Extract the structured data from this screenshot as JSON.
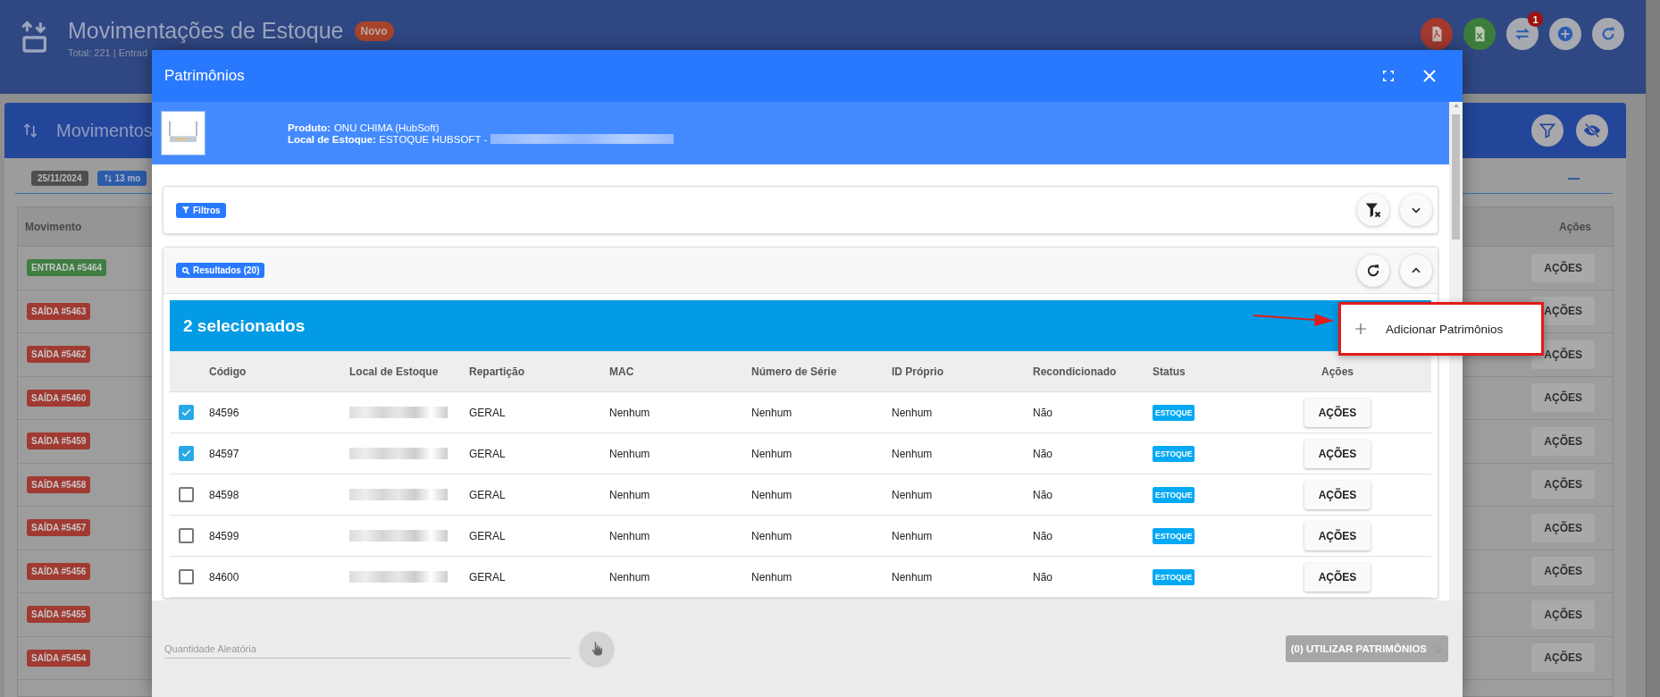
{
  "page": {
    "title": "Movimentações de Estoque",
    "badge": "Novo",
    "subtitle": "Total: 221 | Entrad",
    "header_actions": [
      {
        "kind": "pdf"
      },
      {
        "kind": "excel"
      },
      {
        "kind": "transfer",
        "badge": "1"
      },
      {
        "kind": "add"
      },
      {
        "kind": "refresh"
      }
    ]
  },
  "panel": {
    "title": "Movimentos",
    "chips": [
      {
        "kind": "date",
        "label": "25/11/2024"
      },
      {
        "kind": "count",
        "label": "13 mo"
      }
    ],
    "columns": [
      "Movimento",
      "Ações"
    ],
    "rows": [
      {
        "kind": "entrada",
        "label": "ENTRADA #5464",
        "action": "AÇÕES"
      },
      {
        "kind": "saida",
        "label": "SAÍDA #5463",
        "action": "AÇÕES"
      },
      {
        "kind": "saida",
        "label": "SAÍDA #5462",
        "action": "AÇÕES"
      },
      {
        "kind": "saida",
        "label": "SAÍDA #5460",
        "action": "AÇÕES"
      },
      {
        "kind": "saida",
        "label": "SAÍDA #5459",
        "action": "AÇÕES"
      },
      {
        "kind": "saida",
        "label": "SAÍDA #5458",
        "action": "AÇÕES"
      },
      {
        "kind": "saida",
        "label": "SAÍDA #5457",
        "action": "AÇÕES"
      },
      {
        "kind": "saida",
        "label": "SAÍDA #5456",
        "action": "AÇÕES"
      },
      {
        "kind": "saida",
        "label": "SAÍDA #5455",
        "action": "AÇÕES"
      },
      {
        "kind": "saida",
        "label": "SAÍDA #5454",
        "action": "AÇÕES"
      }
    ]
  },
  "dialog": {
    "title": "Patrimônios",
    "product_label": "Produto:",
    "product": "ONU CHIMA (HubSoft)",
    "location_label": "Local de Estoque:",
    "location": "ESTOQUE HUBSOFT -",
    "filters_label": "Filtros",
    "results_label": "Resultados (20)",
    "selection_title": "2 selecionados",
    "menu": [
      {
        "label": "Adicionar Patrimônios"
      }
    ],
    "columns": [
      "Código",
      "Local de Estoque",
      "Repartição",
      "MAC",
      "Número de Série",
      "ID Próprio",
      "Recondicionado",
      "Status",
      "Ações"
    ],
    "rows": [
      {
        "checked": true,
        "code": "84596",
        "division": "GERAL",
        "mac": "Nenhum",
        "serial": "Nenhum",
        "own_id": "Nenhum",
        "refurbished": "Não",
        "status": "ESTOQUE",
        "action": "AÇÕES"
      },
      {
        "checked": true,
        "code": "84597",
        "division": "GERAL",
        "mac": "Nenhum",
        "serial": "Nenhum",
        "own_id": "Nenhum",
        "refurbished": "Não",
        "status": "ESTOQUE",
        "action": "AÇÕES"
      },
      {
        "checked": false,
        "code": "84598",
        "division": "GERAL",
        "mac": "Nenhum",
        "serial": "Nenhum",
        "own_id": "Nenhum",
        "refurbished": "Não",
        "status": "ESTOQUE",
        "action": "AÇÕES"
      },
      {
        "checked": false,
        "code": "84599",
        "division": "GERAL",
        "mac": "Nenhum",
        "serial": "Nenhum",
        "own_id": "Nenhum",
        "refurbished": "Não",
        "status": "ESTOQUE",
        "action": "AÇÕES"
      },
      {
        "checked": false,
        "code": "84600",
        "division": "GERAL",
        "mac": "Nenhum",
        "serial": "Nenhum",
        "own_id": "Nenhum",
        "refurbished": "Não",
        "status": "ESTOQUE",
        "action": "AÇÕES"
      }
    ],
    "random_qty": {
      "placeholder": "Quantidade Aleatória"
    },
    "use_button": {
      "label": "(0) UTILIZAR PATRIMÔNIOS",
      "disabled": true
    }
  }
}
